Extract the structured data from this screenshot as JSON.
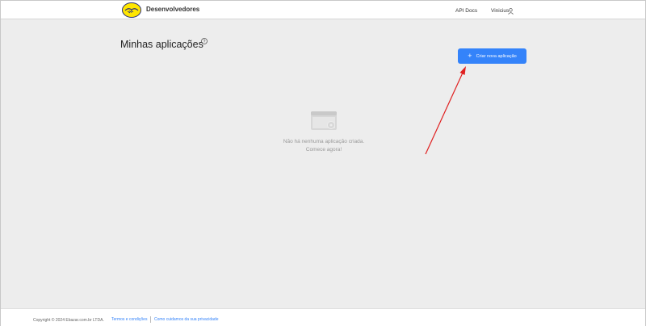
{
  "header": {
    "brand": "Desenvolvedores",
    "nav": {
      "api_docs": "API Docs",
      "user": "Vinicius"
    }
  },
  "main": {
    "title": "Minhas aplicações",
    "create_button": "Criar nova aplicação",
    "empty_state": {
      "line1": "Não há nenhuma aplicação criada.",
      "line2": "Comece agora!"
    }
  },
  "footer": {
    "copyright": "Copyright © 2024 Ebazar.com.br LTDA.",
    "links": [
      "Termos e condições",
      "Como cuidamos da sua privacidade"
    ]
  },
  "colors": {
    "accent": "#3483fa",
    "logo": "#ffe600",
    "arrow": "#e02020"
  },
  "icons": [
    "mercado-libre-handshake-icon",
    "user-icon",
    "help-icon",
    "plus-icon",
    "empty-app-card-icon"
  ]
}
